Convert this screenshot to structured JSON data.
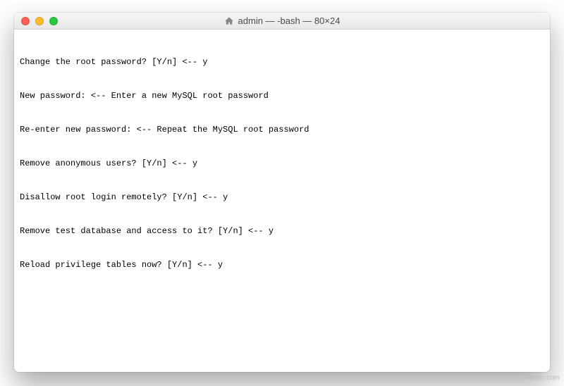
{
  "window": {
    "title": "admin — -bash — 80×24"
  },
  "terminal": {
    "lines": [
      "Change the root password? [Y/n] <-- y",
      "New password: <-- Enter a new MySQL root password",
      "Re-enter new password: <-- Repeat the MySQL root password",
      "Remove anonymous users? [Y/n] <-- y",
      "Disallow root login remotely? [Y/n] <-- y",
      "Remove test database and access to it? [Y/n] <-- y",
      "Reload privilege tables now? [Y/n] <-- y"
    ]
  },
  "watermark": "wsxdn.com"
}
